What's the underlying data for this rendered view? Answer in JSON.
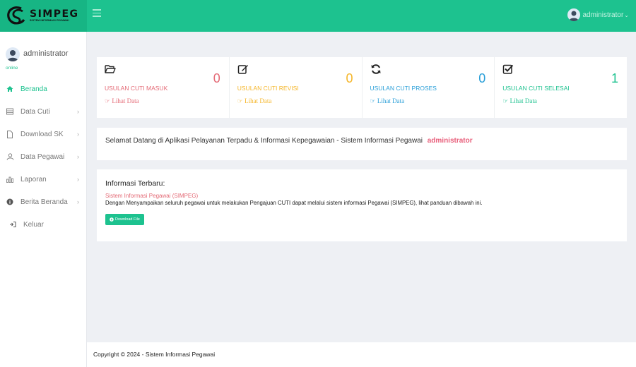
{
  "brand": {
    "name": "SIMPEG",
    "subtitle": "SISTEM INFORMASI PEGAWAI"
  },
  "topbar": {
    "user_name": "administrator"
  },
  "sidebar": {
    "user": {
      "name": "administrator",
      "status": "online"
    },
    "items": [
      {
        "label": "Beranda",
        "icon": "home-icon"
      },
      {
        "label": "Data Cuti",
        "icon": "table-icon"
      },
      {
        "label": "Download SK",
        "icon": "file-icon"
      },
      {
        "label": "Data Pegawai",
        "icon": "users-icon"
      },
      {
        "label": "Laporan",
        "icon": "chart-icon"
      },
      {
        "label": "Berita Beranda",
        "icon": "info-icon"
      },
      {
        "label": "Keluar",
        "icon": "logout-icon"
      }
    ]
  },
  "stats": [
    {
      "label": "USULAN CUTI MASUK",
      "count": "0",
      "link": "Lihat Data",
      "color": "#e46a76",
      "icon": "folder-open-icon"
    },
    {
      "label": "USULAN CUTI REVISI",
      "count": "0",
      "link": "Lihat Data",
      "color": "#f5b62a",
      "icon": "edit-icon"
    },
    {
      "label": "USULAN CUTI PROSES",
      "count": "0",
      "link": "Lihat Data",
      "color": "#2a9fd8",
      "icon": "refresh-icon"
    },
    {
      "label": "USULAN CUTI SELESAI",
      "count": "1",
      "link": "Lihat Data",
      "color": "#1dc28f",
      "icon": "check-square-icon"
    }
  ],
  "welcome": {
    "text": "Selamat Datang di Aplikasi Pelayanan Terpadu & Informasi Kepegawaian - Sistem Informasi Pegawai",
    "user": "administrator"
  },
  "info": {
    "title": "Informasi Terbaru:",
    "subtitle": "Sistem Informasi Pegawai (SIMPEG)",
    "description": "Dengan Menyampaikan seluruh pegawai untuk melakukan Pengajuan CUTI dapat melalui sistem informasi Pegawai (SIMPEG), lihat panduan dibawah ini.",
    "button": "Download File"
  },
  "footer": {
    "text": "Copyright © 2024 - Sistem Informasi Pegawai"
  }
}
